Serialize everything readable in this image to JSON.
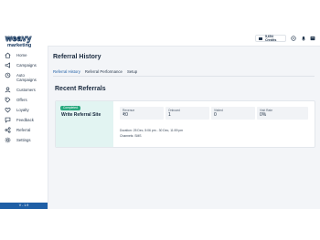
{
  "brand": {
    "name": "weavy",
    "tagline": "marketing"
  },
  "sidebar": {
    "items": [
      {
        "label": "Home",
        "icon": "home-icon"
      },
      {
        "label": "Campaigns",
        "icon": "campaigns-icon"
      },
      {
        "label": "Auto\nCampaigns",
        "icon": "auto-campaigns-icon"
      },
      {
        "label": "Customers",
        "icon": "customers-icon"
      },
      {
        "label": "Offers",
        "icon": "offers-icon"
      },
      {
        "label": "Loyalty",
        "icon": "loyalty-icon"
      },
      {
        "label": "Feedback",
        "icon": "feedback-icon"
      },
      {
        "label": "Referral",
        "icon": "referral-icon"
      },
      {
        "label": "Settings",
        "icon": "settings-icon"
      }
    ],
    "footer": "V - 1.9"
  },
  "topbar": {
    "credits": "5,654 Credits",
    "icons": [
      "help-icon",
      "notifications-icon",
      "profile-icon"
    ]
  },
  "page": {
    "title": "Referral History",
    "tabs": [
      "Referral History",
      "Referral Performance",
      "Setup"
    ],
    "active_tab": "Referral History"
  },
  "recent": {
    "title": "Recent Referrals",
    "card": {
      "badge": "Completed",
      "title": "Write Referral Site",
      "stats": [
        {
          "label": "Revenue",
          "value": "₹0"
        },
        {
          "label": "Onboard",
          "value": "1"
        },
        {
          "label": "Visited",
          "value": "0"
        },
        {
          "label": "Visit Rate",
          "value": "0%"
        }
      ],
      "duration": "Duration: 25 Dec, 5:06 pm - 30 Dec, 11:59 pm",
      "channels": "Channels: SMS"
    }
  },
  "colors": {
    "brand_navy": "#12345c",
    "accent_blue": "#1f5fa6",
    "badge_green": "#27a97e",
    "card_mint": "#e2f4f2",
    "background": "#f3f5f8"
  }
}
